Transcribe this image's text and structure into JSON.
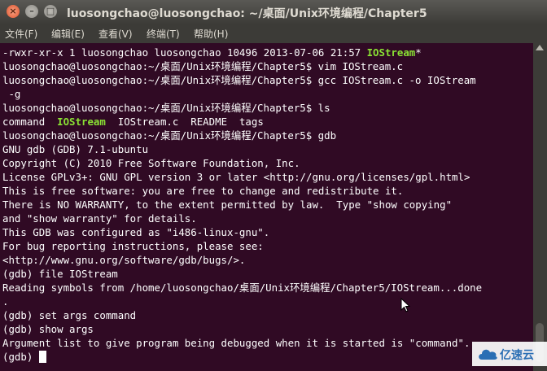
{
  "window": {
    "title": "luosongchao@luosongchao: ~/桌面/Unix环境编程/Chapter5",
    "controls": {
      "close": "×",
      "minimize": "–",
      "maximize": "□"
    }
  },
  "menu": [
    {
      "label": "文件(F)"
    },
    {
      "label": "编辑(E)"
    },
    {
      "label": "查看(V)"
    },
    {
      "label": "终端(T)"
    },
    {
      "label": "帮助(H)"
    }
  ],
  "terminal": {
    "lines": [
      {
        "pre": "-rwxr-xr-x 1 luosongchao luosongchao 10496 2013-07-06 21:57 ",
        "hl": "IOStream",
        "post": "*"
      },
      {
        "pre": "luosongchao@luosongchao:~/桌面/Unix环境编程/Chapter5$ vim IOStream.c",
        "hl": "",
        "post": ""
      },
      {
        "pre": "luosongchao@luosongchao:~/桌面/Unix环境编程/Chapter5$ gcc IOStream.c -o IOStream",
        "hl": "",
        "post": ""
      },
      {
        "pre": " -g",
        "hl": "",
        "post": ""
      },
      {
        "pre": "luosongchao@luosongchao:~/桌面/Unix环境编程/Chapter5$ ls",
        "hl": "",
        "post": ""
      },
      {
        "pre": "command  ",
        "hl": "IOStream",
        "post": "  IOStream.c  README  tags"
      },
      {
        "pre": "luosongchao@luosongchao:~/桌面/Unix环境编程/Chapter5$ gdb",
        "hl": "",
        "post": ""
      },
      {
        "pre": "GNU gdb (GDB) 7.1-ubuntu",
        "hl": "",
        "post": ""
      },
      {
        "pre": "Copyright (C) 2010 Free Software Foundation, Inc.",
        "hl": "",
        "post": ""
      },
      {
        "pre": "License GPLv3+: GNU GPL version 3 or later <http://gnu.org/licenses/gpl.html>",
        "hl": "",
        "post": ""
      },
      {
        "pre": "This is free software: you are free to change and redistribute it.",
        "hl": "",
        "post": ""
      },
      {
        "pre": "There is NO WARRANTY, to the extent permitted by law.  Type \"show copying\"",
        "hl": "",
        "post": ""
      },
      {
        "pre": "and \"show warranty\" for details.",
        "hl": "",
        "post": ""
      },
      {
        "pre": "This GDB was configured as \"i486-linux-gnu\".",
        "hl": "",
        "post": ""
      },
      {
        "pre": "For bug reporting instructions, please see:",
        "hl": "",
        "post": ""
      },
      {
        "pre": "<http://www.gnu.org/software/gdb/bugs/>.",
        "hl": "",
        "post": ""
      },
      {
        "pre": "(gdb) file IOStream",
        "hl": "",
        "post": ""
      },
      {
        "pre": "Reading symbols from /home/luosongchao/桌面/Unix环境编程/Chapter5/IOStream...done",
        "hl": "",
        "post": ""
      },
      {
        "pre": ".",
        "hl": "",
        "post": ""
      },
      {
        "pre": "(gdb) set args command",
        "hl": "",
        "post": ""
      },
      {
        "pre": "(gdb) show args",
        "hl": "",
        "post": ""
      },
      {
        "pre": "Argument list to give program being debugged when it is started is \"command\".",
        "hl": "",
        "post": ""
      },
      {
        "pre": "(gdb) ",
        "hl": "",
        "post": ""
      }
    ]
  },
  "watermark": {
    "text": "亿速云"
  },
  "colors": {
    "terminal_bg": "#300a24",
    "highlight": "#8ae234",
    "chrome": "#3c3b37"
  }
}
